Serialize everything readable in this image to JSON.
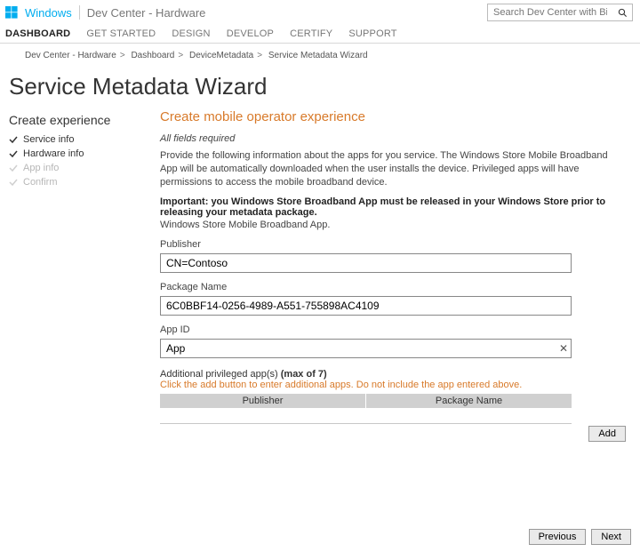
{
  "header": {
    "brand": "Windows",
    "portal": "Dev Center - Hardware",
    "search_placeholder": "Search Dev Center with Bing"
  },
  "nav": {
    "items": [
      "DASHBOARD",
      "GET STARTED",
      "DESIGN",
      "DEVELOP",
      "CERTIFY",
      "SUPPORT"
    ],
    "active_index": 0
  },
  "breadcrumb": [
    "Dev Center - Hardware",
    "Dashboard",
    "DeviceMetadata",
    "Service Metadata Wizard"
  ],
  "page_title": "Service Metadata Wizard",
  "sidebar": {
    "title": "Create experience",
    "steps": [
      {
        "label": "Service info",
        "done": true
      },
      {
        "label": "Hardware info",
        "done": true
      },
      {
        "label": "App info",
        "done": false
      },
      {
        "label": "Confirm",
        "done": false
      }
    ]
  },
  "main": {
    "section_title": "Create mobile operator experience",
    "required_note": "All fields required",
    "description": "Provide the following information about the apps for you service. The Windows Store Mobile Broadband App will be automatically downloaded when the user installs the device. Privileged apps will have permissions to access the mobile broadband device.",
    "important": "Important: you Windows Store Broadband App must be released in your Windows Store prior to releasing your metadata package.",
    "subline": "Windows Store Mobile Broadband App.",
    "fields": {
      "publisher_label": "Publisher",
      "publisher_value": "CN=Contoso",
      "package_label": "Package Name",
      "package_value": "6C0BBF14-0256-4989-A551-755898AC4109",
      "appid_label": "App ID",
      "appid_value": "App"
    },
    "additional": {
      "label": "Additional privileged app(s) ",
      "max": "(max of 7)",
      "hint": "Click the add button to enter additional apps. Do not include the app entered above.",
      "col1": "Publisher",
      "col2": "Package Name",
      "add_label": "Add"
    }
  },
  "footer": {
    "prev": "Previous",
    "next": "Next"
  }
}
